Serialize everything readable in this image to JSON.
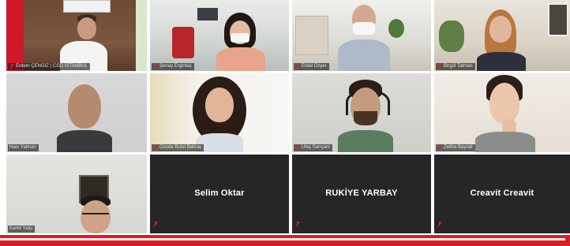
{
  "participants": [
    {
      "id": "p1",
      "name": "Erdem ÇENGİZ | CGD İSTANBUL"
    },
    {
      "id": "p2",
      "name": "Şenay Ergintaş"
    },
    {
      "id": "p3",
      "name": "Erdal Özyer"
    },
    {
      "id": "p4",
      "name": "Birgül Tatman"
    },
    {
      "id": "p5",
      "name": "Hacı Yalman"
    },
    {
      "id": "p6",
      "name": "Gözde Bulut Bektaş"
    },
    {
      "id": "p7",
      "name": "Ulaş Sarıçam"
    },
    {
      "id": "p8",
      "name": "Zeliha Bayrak"
    },
    {
      "id": "p9",
      "name": "Kamil Yalçı"
    },
    {
      "id": "p10",
      "name": "Selim Oktar"
    },
    {
      "id": "p11",
      "name": "RUKİYE YARBAY"
    },
    {
      "id": "p12",
      "name": "Creavit Creavit"
    }
  ],
  "colors": {
    "accent": "#e11b22",
    "empty_tile": "#262626",
    "mic_off": "#e11b22"
  },
  "icons": {
    "mic_off": "mic-off-icon"
  }
}
